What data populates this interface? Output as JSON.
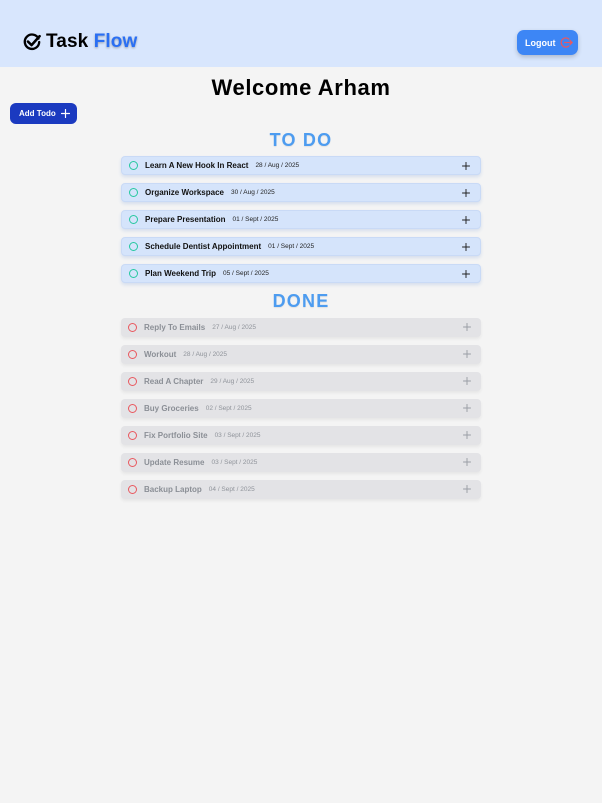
{
  "header": {
    "brand_task": "Task",
    "brand_flow": "Flow",
    "logout_label": "Logout",
    "brand_icon": "check-circle-icon",
    "logout_icon": "logout-icon"
  },
  "welcome": "Welcome Arham",
  "add_todo": {
    "label": "Add Todo",
    "icon": "plus-icon"
  },
  "todo_section": {
    "title": "TO DO",
    "items": [
      {
        "title": "Learn A New Hook In React",
        "date": "28 / Aug / 2025"
      },
      {
        "title": "Organize Workspace",
        "date": "30 / Aug / 2025"
      },
      {
        "title": "Prepare Presentation",
        "date": "01 / Sept / 2025"
      },
      {
        "title": "Schedule Dentist Appointment",
        "date": "01 / Sept / 2025"
      },
      {
        "title": "Plan Weekend Trip",
        "date": "05 / Sept / 2025"
      }
    ]
  },
  "done_section": {
    "title": "DONE",
    "items": [
      {
        "title": "Reply To Emails",
        "date": "27 / Aug / 2025"
      },
      {
        "title": "Workout",
        "date": "28 / Aug / 2025"
      },
      {
        "title": "Read A Chapter",
        "date": "29 / Aug / 2025"
      },
      {
        "title": "Buy Groceries",
        "date": "02 / Sept / 2025"
      },
      {
        "title": "Fix Portfolio Site",
        "date": "03 / Sept / 2025"
      },
      {
        "title": "Update Resume",
        "date": "03 / Sept / 2025"
      },
      {
        "title": "Backup Laptop",
        "date": "04 / Sept / 2025"
      }
    ]
  },
  "colors": {
    "header_bg": "#d8e6fd",
    "page_bg": "#f4f4f4",
    "brand_accent": "#2a6ff3",
    "logout_bg": "#3d86f5",
    "logout_icon": "#e9585f",
    "add_bg": "#1b3ac0",
    "section_title": "#4d9cf0",
    "todo_circle": "#27c8a0",
    "done_circle": "#e9585f"
  }
}
